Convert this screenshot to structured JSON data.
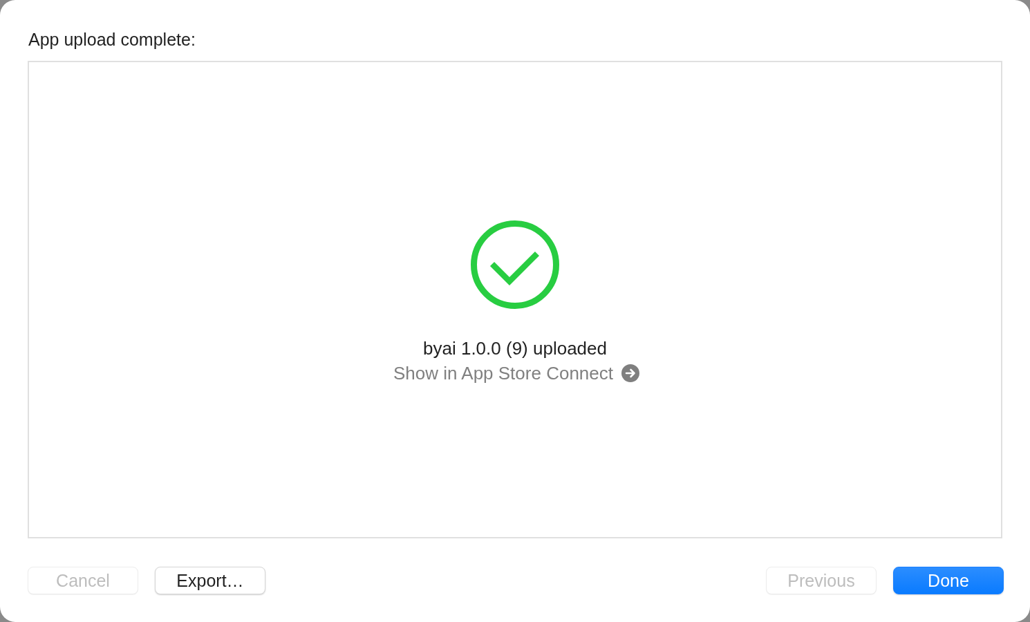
{
  "window": {
    "title": "App upload complete:"
  },
  "result": {
    "kind": "success",
    "message": "byai 1.0.0 (9) uploaded",
    "link": "Show in App Store Connect"
  },
  "buttons_left": [
    {
      "label": "Cancel",
      "disabled": true,
      "default": false
    },
    {
      "label": "Export…",
      "disabled": false,
      "default": false
    }
  ],
  "buttons_right": [
    {
      "label": "Previous",
      "disabled": true,
      "default": false
    },
    {
      "label": "Done",
      "disabled": false,
      "default": true
    }
  ]
}
